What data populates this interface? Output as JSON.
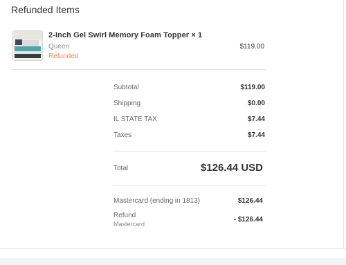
{
  "section_title": "Refunded Items",
  "item": {
    "name": "2-Inch Gel Swirl Memory Foam Topper × 1",
    "variant": "Queen",
    "status": "Refunded",
    "price": "$119.00",
    "thumbnail_icon": "mattress-topper-photo"
  },
  "summary": {
    "subtotal_label": "Subtotal",
    "subtotal_value": "$119.00",
    "shipping_label": "Shipping",
    "shipping_value": "$0.00",
    "tax1_label": "IL STATE TAX",
    "tax1_value": "$7.44",
    "taxes_label": "Taxes",
    "taxes_value": "$7.44"
  },
  "total": {
    "label": "Total",
    "value": "$126.44 USD"
  },
  "payment": {
    "label": "Mastercard (ending in 1813)",
    "value": "$126.44"
  },
  "refund": {
    "label": "Refund",
    "sub_label": "Mastercard",
    "value": "- $126.44"
  },
  "colors": {
    "refunded_status": "#e8894f",
    "text": "#333333",
    "muted": "#8a8a8a",
    "divider": "#e3e3e3"
  }
}
